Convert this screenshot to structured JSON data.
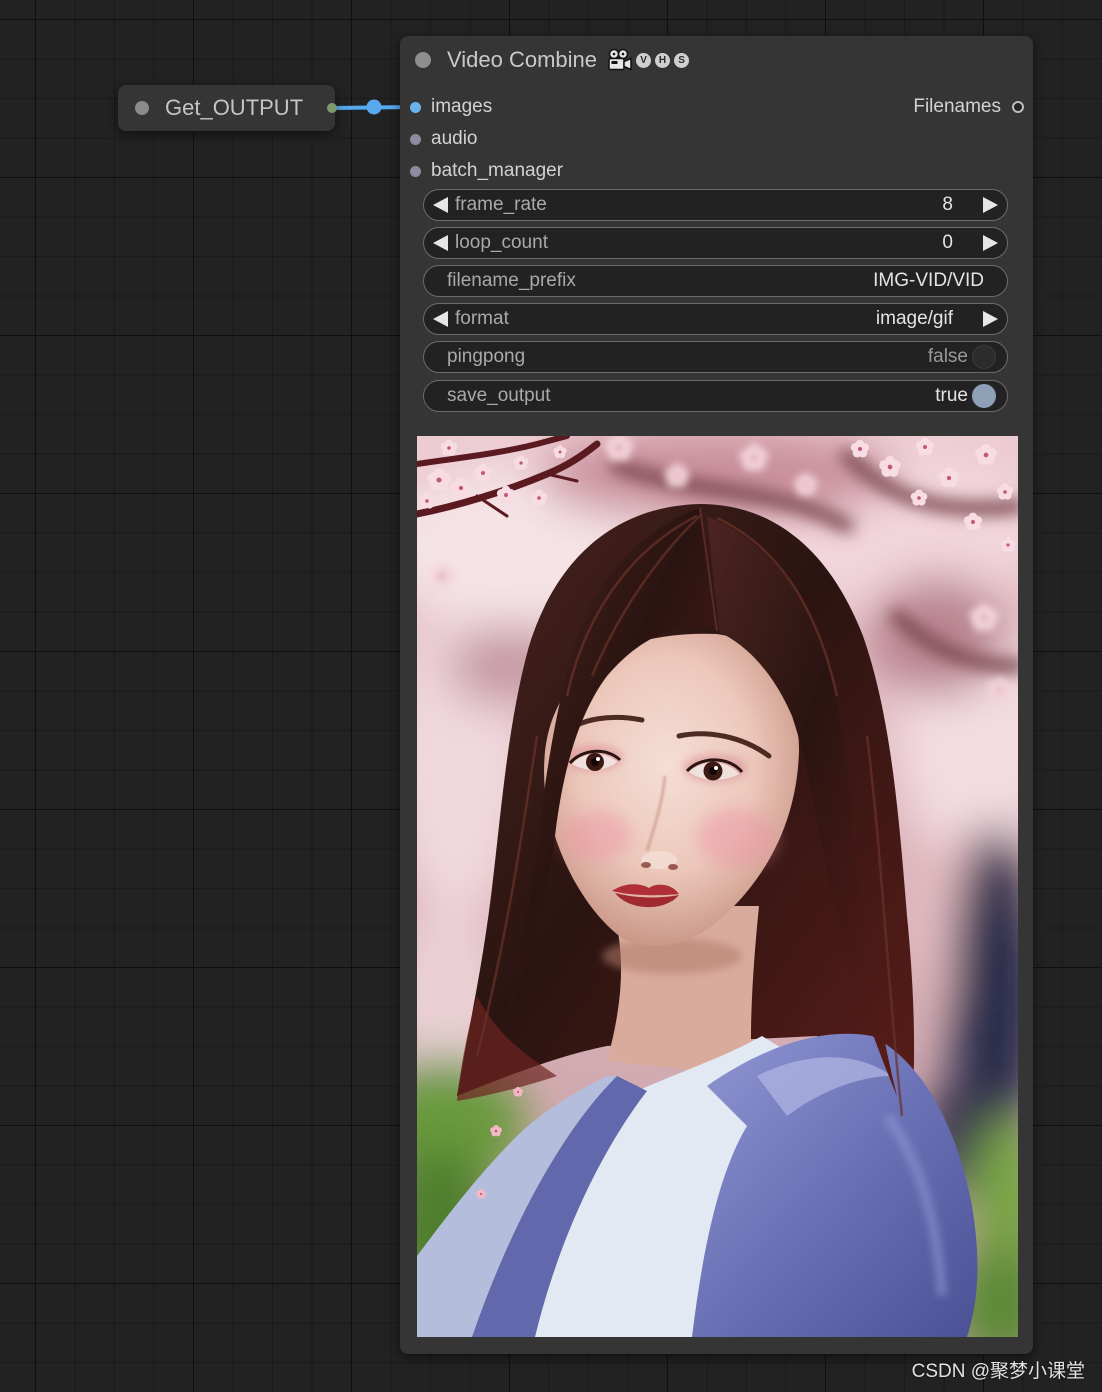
{
  "colors": {
    "canvas_bg": "#222222",
    "node_bg": "#353535",
    "link": "#58a8ee",
    "images_slot": "#6ab2ec",
    "get_output_slot": "#7d9b6a",
    "toggle_on": "#8da0b6"
  },
  "get_node": {
    "title": "Get_OUTPUT"
  },
  "video_combine": {
    "title": "Video Combine",
    "title_icon": "film-camera-icon",
    "badges": [
      "V",
      "H",
      "S"
    ],
    "inputs": [
      {
        "label": "images",
        "connected": true
      },
      {
        "label": "audio",
        "connected": false
      },
      {
        "label": "batch_manager",
        "connected": false
      }
    ],
    "outputs": [
      {
        "label": "Filenames"
      }
    ],
    "widgets": [
      {
        "label": "frame_rate",
        "value": "8",
        "arrows": true
      },
      {
        "label": "loop_count",
        "value": "0",
        "arrows": true
      },
      {
        "label": "filename_prefix",
        "value": "IMG-VID/VID",
        "arrows": false
      },
      {
        "label": "format",
        "value": "image/gif",
        "arrows": true
      },
      {
        "label": "pingpong",
        "value": "false",
        "arrows": false,
        "toggle_on": false
      },
      {
        "label": "save_output",
        "value": "true",
        "arrows": false,
        "toggle_on": true
      }
    ]
  },
  "watermark": "CSDN @聚梦小课堂"
}
